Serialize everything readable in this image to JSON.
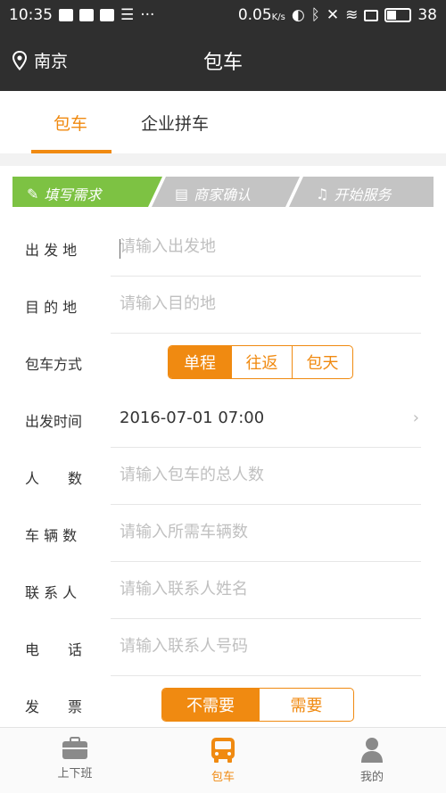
{
  "status_bar": {
    "time": "10:35",
    "speed": "0.05",
    "speed_unit": "K/s",
    "battery": "38"
  },
  "header": {
    "location": "南京",
    "title": "包车"
  },
  "tabs": [
    {
      "label": "包车",
      "active": true
    },
    {
      "label": "企业拼车",
      "active": false
    }
  ],
  "steps": [
    {
      "label": "填写需求",
      "active": true
    },
    {
      "label": "商家确认",
      "active": false
    },
    {
      "label": "开始服务",
      "active": false
    }
  ],
  "form": {
    "departure": {
      "label": "出 发 地",
      "placeholder": "请输入出发地"
    },
    "destination": {
      "label": "目 的 地",
      "placeholder": "请输入目的地"
    },
    "charter_mode": {
      "label": "包车方式",
      "options": [
        "单程",
        "往返",
        "包天"
      ],
      "selected": "单程"
    },
    "departure_time": {
      "label": "出发时间",
      "value": "2016-07-01 07:00"
    },
    "people": {
      "label": "人　　数",
      "placeholder": "请输入包车的总人数"
    },
    "vehicles": {
      "label": "车 辆 数",
      "placeholder": "请输入所需车辆数"
    },
    "contact": {
      "label": "联 系 人",
      "placeholder": "请输入联系人姓名"
    },
    "phone": {
      "label": "电　　话",
      "placeholder": "请输入联系人号码"
    },
    "invoice": {
      "label": "发　　票",
      "options": [
        "不需要",
        "需要"
      ],
      "selected": "不需要"
    }
  },
  "bottom_nav": [
    {
      "label": "上下班",
      "icon": "briefcase-icon",
      "active": false
    },
    {
      "label": "包车",
      "icon": "bus-icon",
      "active": true
    },
    {
      "label": "我的",
      "icon": "user-icon",
      "active": false
    }
  ],
  "colors": {
    "accent": "#f08a11",
    "step_active": "#7dc243",
    "step_inactive": "#c4c4c4",
    "header_bg": "#2f2f2f"
  }
}
